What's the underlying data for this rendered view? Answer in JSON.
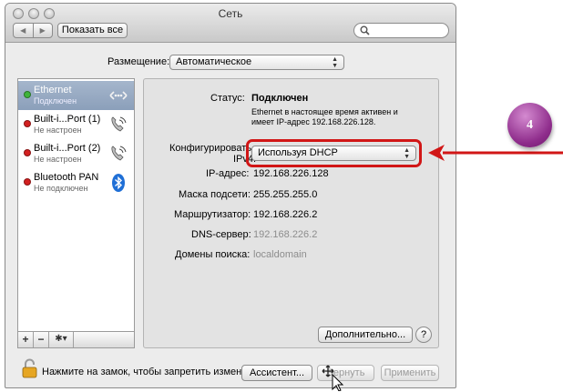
{
  "window": {
    "title": "Сеть",
    "show_all_label": "Показать все",
    "search_placeholder": ""
  },
  "location": {
    "label": "Размещение:",
    "value": "Автоматическое"
  },
  "services": [
    {
      "name": "Ethernet",
      "status": "Подключен",
      "status_color": "#3fb43a",
      "icon": "ethernet-icon",
      "selected": true
    },
    {
      "name": "Built-i...Port (1)",
      "status": "Не настроен",
      "status_color": "#d32020",
      "icon": "phone-modem-icon",
      "selected": false
    },
    {
      "name": "Built-i...Port (2)",
      "status": "Не настроен",
      "status_color": "#d32020",
      "icon": "phone-modem-icon",
      "selected": false
    },
    {
      "name": "Bluetooth PAN",
      "status": "Не подключен",
      "status_color": "#d32020",
      "icon": "bluetooth-icon",
      "selected": false
    }
  ],
  "sidebar_controls": {
    "add": "+",
    "remove": "−",
    "gear": "✱▾"
  },
  "details": {
    "status_label": "Статус:",
    "status_value": "Подключен",
    "status_desc_1": "Ethernet в настоящее время активен и",
    "status_desc_2": "имеет IP-адрес 192.168.226.128.",
    "config_label_1": "Конфигурировать",
    "config_label_2": "IPv4:",
    "config_value": "Используя DHCP",
    "ip_label": "IP-адрес:",
    "ip_value": "192.168.226.128",
    "mask_label": "Маска подсети:",
    "mask_value": "255.255.255.0",
    "router_label": "Маршрутизатор:",
    "router_value": "192.168.226.2",
    "dns_label": "DNS-сервер:",
    "dns_value": "192.168.226.2",
    "search_domains_label": "Домены поиска:",
    "search_domains_value": "localdomain",
    "advanced_label": "Дополнительно...",
    "help_label": "?"
  },
  "footer": {
    "lock_text": "Нажмите на замок, чтобы запретить изменения.",
    "assistant_label": "Ассистент...",
    "revert_label": "Вернуть",
    "apply_label": "Применить"
  },
  "annotation": {
    "step_number": "4",
    "accent_color": "#d11616",
    "badge_color": "#8e2c8b"
  }
}
